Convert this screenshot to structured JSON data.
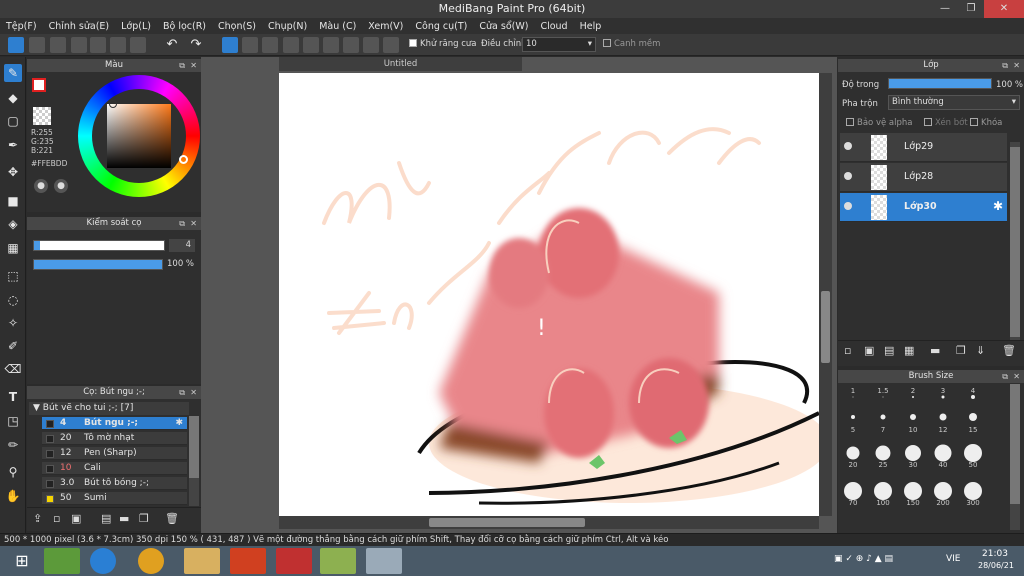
{
  "window": {
    "title": "MediBang Paint Pro (64bit)"
  },
  "menu": [
    "Tệp(F)",
    "Chỉnh sửa(E)",
    "Lớp(L)",
    "Bộ lọc(R)",
    "Chọn(S)",
    "Chụp(N)",
    "Màu (C)",
    "Xem(V)",
    "Công cụ(T)",
    "Cửa sổ(W)",
    "Cloud",
    "Help"
  ],
  "toolbar": {
    "antialias_label": "Khử răng cưa",
    "adjust_label": "Điều chỉnh",
    "adjust_value": "10",
    "snap_label": "Canh mềm"
  },
  "color_panel": {
    "title": "Màu",
    "r": "R:255",
    "g": "G:235",
    "b": "B:221",
    "hex": "#FFEBDD",
    "fg": "#FFEBDD",
    "accent": "#2E7FD0"
  },
  "brush_control": {
    "title": "Kiểm soát cọ",
    "size": "4",
    "opacity": "100 %"
  },
  "brush_panel": {
    "title": "Cọ: Bút ngu ;-;",
    "group": "Bút vẽ cho tui ;-; [7]",
    "items": [
      {
        "size": "4",
        "name": "Bút ngu ;-;",
        "swatch": "#222222"
      },
      {
        "size": "20",
        "name": "Tô mờ nhạt",
        "swatch": "#222222"
      },
      {
        "size": "12",
        "name": "Pen (Sharp)",
        "swatch": "#222222"
      },
      {
        "size": "10",
        "name": "Cali",
        "swatch": "#222222"
      },
      {
        "size": "3.0",
        "name": "Bút tô bóng ;-;",
        "swatch": "#222222"
      },
      {
        "size": "50",
        "name": "Sumi",
        "swatch": "#F5D400"
      }
    ]
  },
  "canvas": {
    "tab": "Untitled"
  },
  "layer_panel": {
    "title": "Lớp",
    "opacity_label": "Độ trong",
    "opacity_value": "100 %",
    "blend_label": "Pha trộn",
    "blend_value": "Bình thường",
    "alpha_label": "Bảo vệ alpha",
    "clip_label": "Xén bớt",
    "lock_label": "Khóa",
    "layers": [
      "Lớp29",
      "Lớp28",
      "Lớp30"
    ]
  },
  "brush_size_panel": {
    "title": "Brush Size",
    "sizes": [
      "1",
      "1.5",
      "2",
      "3",
      "4",
      "5",
      "7",
      "10",
      "12",
      "15",
      "20",
      "25",
      "30",
      "40",
      "50",
      "70",
      "100",
      "150",
      "200",
      "300"
    ]
  },
  "status": {
    "text": "500 * 1000 pixel   (3.6 * 7.3cm)   350 dpi   150 %   ( 431, 487 )   Vẽ một đường thẳng bằng cách giữ phím Shift, Thay đổi cỡ cọ bằng cách giữ phím Ctrl, Alt và kéo"
  },
  "taskbar": {
    "lang": "VIE",
    "time": "21:03",
    "date": "28/06/21"
  }
}
